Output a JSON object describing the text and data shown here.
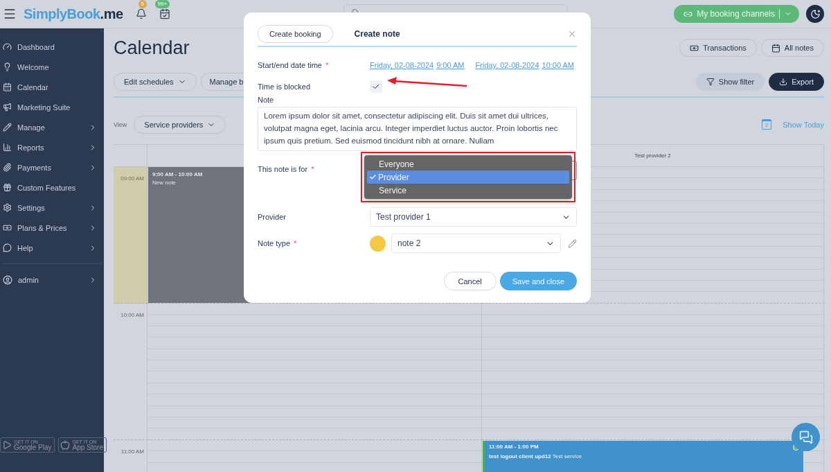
{
  "topbar": {
    "logo": {
      "name": "SimplyBook",
      "suffix": ".me"
    },
    "notifications": "5",
    "tasks": "99+",
    "channels_button": "My booking channels"
  },
  "sidebar": {
    "items": [
      {
        "label": "Dashboard",
        "has_submenu": false
      },
      {
        "label": "Welcome",
        "has_submenu": false
      },
      {
        "label": "Calendar",
        "has_submenu": false
      },
      {
        "label": "Marketing Suite",
        "has_submenu": false
      },
      {
        "label": "Manage",
        "has_submenu": true
      },
      {
        "label": "Reports",
        "has_submenu": true
      },
      {
        "label": "Payments",
        "has_submenu": true
      },
      {
        "label": "Custom Features",
        "has_submenu": false
      },
      {
        "label": "Settings",
        "has_submenu": true
      },
      {
        "label": "Plans & Prices",
        "has_submenu": true
      },
      {
        "label": "Help",
        "has_submenu": true
      }
    ],
    "account": {
      "label": "admin",
      "has_submenu": true
    },
    "stores": [
      {
        "small": "GET IT ON",
        "name": "Google Play"
      },
      {
        "small": "GET IT ON",
        "name": "App Store"
      }
    ]
  },
  "page": {
    "title": "Calendar",
    "actions": [
      "Edit schedules",
      "Manage b"
    ],
    "top_right": [
      "Transactions",
      "All notes"
    ],
    "show_filter": "Show filter",
    "export": "Export",
    "view_label": "View",
    "view_value": "Service providers",
    "show_today": "Show Today",
    "today_day": "2"
  },
  "calendar": {
    "columns": [
      "",
      "Test provider 2"
    ],
    "hours": [
      {
        "label": "09:00 AM",
        "blocked": true,
        "cells": [
          {
            "kind": "note",
            "time": "9:00 AM - 10:00 AM",
            "title": "New note"
          },
          {
            "kind": "empty"
          }
        ]
      },
      {
        "label": "10:00 AM",
        "blocked": false,
        "cells": [
          {
            "kind": "empty"
          },
          {
            "kind": "empty"
          }
        ]
      },
      {
        "label": "11:00 AM",
        "blocked": false,
        "cells": [
          {
            "kind": "empty"
          },
          {
            "kind": "booking",
            "time": "11:00 AM - 1:00 PM",
            "title": "test logout client upd12",
            "service": "Test service",
            "color": "#4ab04a"
          }
        ]
      }
    ]
  },
  "modal": {
    "tabs": [
      {
        "label": "Create booking",
        "selected": false
      },
      {
        "label": "Create note",
        "selected": true
      }
    ],
    "datetime_label": "Start/end date time",
    "datetime_required": "*",
    "start_date": "Friday, 02-08-2024",
    "start_time": "9:00 AM",
    "end_date": "Friday, 02-08-2024",
    "end_time": "10:00 AM",
    "blocked_label": "Time is blocked",
    "blocked": true,
    "note_label": "Note",
    "note": "Lorem ipsum dolor sit amet, consectetur adipiscing elit. Duis sit amet dui ultrices, volutpat magna eget, lacinia arcu. Integer imperdiet luctus auctor. Proin lobortis nec ipsum quis pretium. Sed euismod tincidunt nibh at ornare. Nullam",
    "for_label": "This note is for",
    "for_required": "*",
    "for_options": [
      {
        "label": "Everyone",
        "selected": false
      },
      {
        "label": "Provider",
        "selected": true
      },
      {
        "label": "Service",
        "selected": false
      }
    ],
    "provider_label": "Provider",
    "provider": "Test provider 1",
    "type_label": "Note type",
    "type_required": "*",
    "type": "note 2",
    "cancel": "Cancel",
    "save": "Save and close"
  }
}
